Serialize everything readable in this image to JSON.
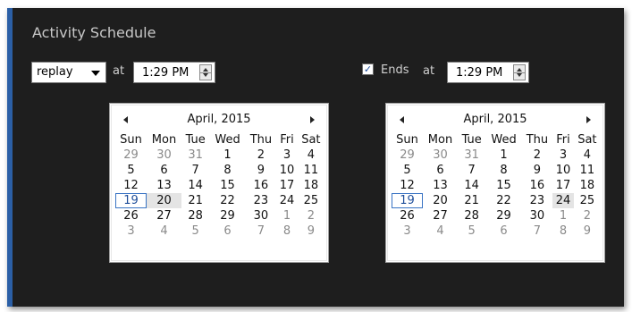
{
  "title": "Activity Schedule",
  "repeat_select": {
    "value": "replay"
  },
  "start": {
    "at_label": "at",
    "time": "1:29 PM"
  },
  "end": {
    "checkbox_label": "Ends",
    "checked": true,
    "at_label": "at",
    "time": "1:29 PM"
  },
  "colors": {
    "panel_bg": "#1e1e1e",
    "accent": "#2b5fa6",
    "today_border": "#3a74c4"
  },
  "calendars": [
    {
      "month_label": "April, 2015",
      "weekdays": [
        "Sun",
        "Mon",
        "Tue",
        "Wed",
        "Thu",
        "Fri",
        "Sat"
      ],
      "weeks": [
        [
          "29",
          "30",
          "31",
          "1",
          "2",
          "3",
          "4"
        ],
        [
          "5",
          "6",
          "7",
          "8",
          "9",
          "10",
          "11"
        ],
        [
          "12",
          "13",
          "14",
          "15",
          "16",
          "17",
          "18"
        ],
        [
          "19",
          "20",
          "21",
          "22",
          "23",
          "24",
          "25"
        ],
        [
          "26",
          "27",
          "28",
          "29",
          "30",
          "1",
          "2"
        ],
        [
          "3",
          "4",
          "5",
          "6",
          "7",
          "8",
          "9"
        ]
      ],
      "today": "19",
      "selected": "20"
    },
    {
      "month_label": "April, 2015",
      "weekdays": [
        "Sun",
        "Mon",
        "Tue",
        "Wed",
        "Thu",
        "Fri",
        "Sat"
      ],
      "weeks": [
        [
          "29",
          "30",
          "31",
          "1",
          "2",
          "3",
          "4"
        ],
        [
          "5",
          "6",
          "7",
          "8",
          "9",
          "10",
          "11"
        ],
        [
          "12",
          "13",
          "14",
          "15",
          "16",
          "17",
          "18"
        ],
        [
          "19",
          "20",
          "21",
          "22",
          "23",
          "24",
          "25"
        ],
        [
          "26",
          "27",
          "28",
          "29",
          "30",
          "1",
          "2"
        ],
        [
          "3",
          "4",
          "5",
          "6",
          "7",
          "8",
          "9"
        ]
      ],
      "today": "19",
      "selected": "24"
    }
  ]
}
